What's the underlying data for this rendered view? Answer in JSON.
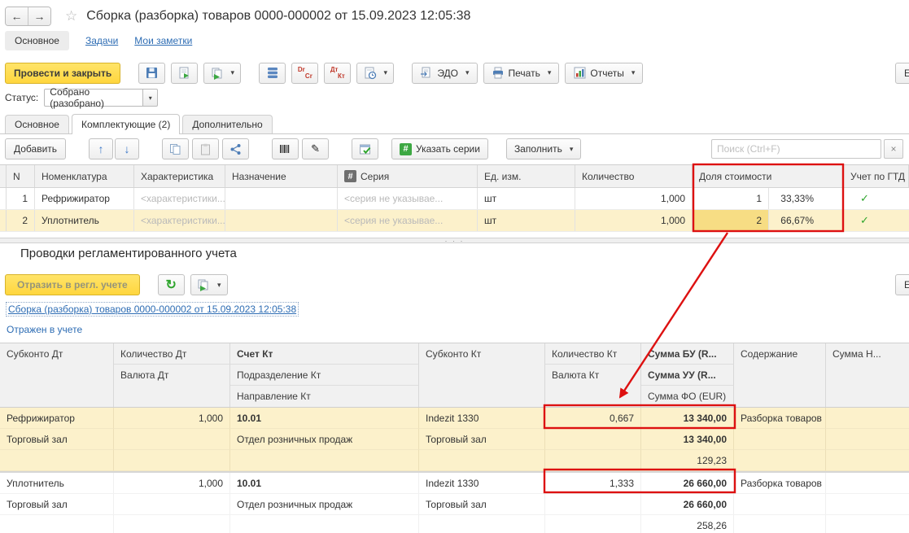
{
  "colors": {
    "accent_yellow": "#FFD63E",
    "annotation_red": "#DD1111",
    "link_blue": "#2E6DB4",
    "check_green": "#2EA52C",
    "row_highlight": "#FCF1CB",
    "active_cell": "#F7DD84"
  },
  "icons": {
    "back": "←",
    "forward": "→",
    "star": "☆",
    "caret": "▾",
    "check": "✓",
    "refresh": "↻",
    "clear": "×",
    "hash": "#",
    "pen": "✎",
    "arrow_up": "↑",
    "arrow_down": "↓",
    "splitter_dots": "· · ·",
    "dr": "Dr",
    "cr": "Cr",
    "dt": "Дт",
    "kt": "Кт"
  },
  "header": {
    "title": "Сборка (разборка) товаров 0000-000002 от 15.09.2023 12:05:38",
    "tabs": [
      "Основное",
      "Задачи",
      "Мои заметки"
    ]
  },
  "toolbar": {
    "post_and_close": "Провести и закрыть",
    "edo": "ЭДО",
    "print": "Печать",
    "reports": "Отчеты",
    "more": "Ещё"
  },
  "status": {
    "label": "Статус:",
    "value": "Собрано (разобрано)"
  },
  "doc_tabs": [
    "Основное",
    "Комплектующие (2)",
    "Дополнительно"
  ],
  "components": {
    "add": "Добавить",
    "series_btn": "Указать серии",
    "fill": "Заполнить",
    "search_placeholder": "Поиск (Ctrl+F)",
    "cols": {
      "n": "N",
      "nom": "Номенклатура",
      "char": "Характеристика",
      "purp": "Назначение",
      "series": "Серия",
      "unit": "Ед. изм.",
      "qty": "Количество",
      "share": "Доля стоимости",
      "gtd": "Учет по ГТД"
    },
    "rows": [
      {
        "n": "1",
        "nom": "Рефрижиратор",
        "char": "<характеристики...",
        "purp": "",
        "series": "<серия не указывае...",
        "unit": "шт",
        "qty": "1,000",
        "share": "1",
        "pct": "33,33%"
      },
      {
        "n": "2",
        "nom": "Уплотнитель",
        "char": "<характеристики...",
        "purp": "",
        "series": "<серия не указывае...",
        "unit": "шт",
        "qty": "1,000",
        "share": "2",
        "pct": "66,67%"
      }
    ]
  },
  "postings": {
    "title": "Проводки регламентированного учета",
    "reflect": "Отразить в регл. учете",
    "more": "Ещё",
    "doc_link": "Сборка (разборка) товаров 0000-000002 от 15.09.2023 12:05:38",
    "status_link": "Отражен в учете",
    "cols": {
      "sub_dt": "Субконто Дт",
      "qty_dt": "Количество Дт",
      "cur_dt": "Валюта Дт",
      "acc_kt": "Счет Кт",
      "dep_kt": "Подразделение Кт",
      "dir_kt": "Направление Кт",
      "sub_kt": "Субконто Кт",
      "qty_kt": "Количество Кт",
      "cur_kt": "Валюта Кт",
      "sum_bu": "Сумма БУ (R...",
      "sum_uu": "Сумма УУ (R...",
      "sum_fo": "Сумма ФО (EUR)",
      "content": "Содержание",
      "sum_n": "Сумма Н..."
    },
    "entries": [
      {
        "sub_dt": "Рефрижиратор",
        "qty_dt": "1,000",
        "acc_kt": "10.01",
        "sub_kt": "Indezit 1330",
        "qty_kt": "0,667",
        "sum_bu": "13 340,00",
        "content": "Разборка товаров",
        "sub_dt2": "Торговый зал",
        "dep_kt": "Отдел розничных продаж",
        "sub_kt2": "Торговый зал",
        "sum_uu": "13 340,00",
        "sum_fo": "129,23"
      },
      {
        "sub_dt": "Уплотнитель",
        "qty_dt": "1,000",
        "acc_kt": "10.01",
        "sub_kt": "Indezit 1330",
        "qty_kt": "1,333",
        "sum_bu": "26 660,00",
        "content": "Разборка товаров",
        "sub_dt2": "Торговый зал",
        "dep_kt": "Отдел розничных продаж",
        "sub_kt2": "Торговый зал",
        "sum_uu": "26 660,00",
        "sum_fo": "258,26"
      }
    ]
  }
}
